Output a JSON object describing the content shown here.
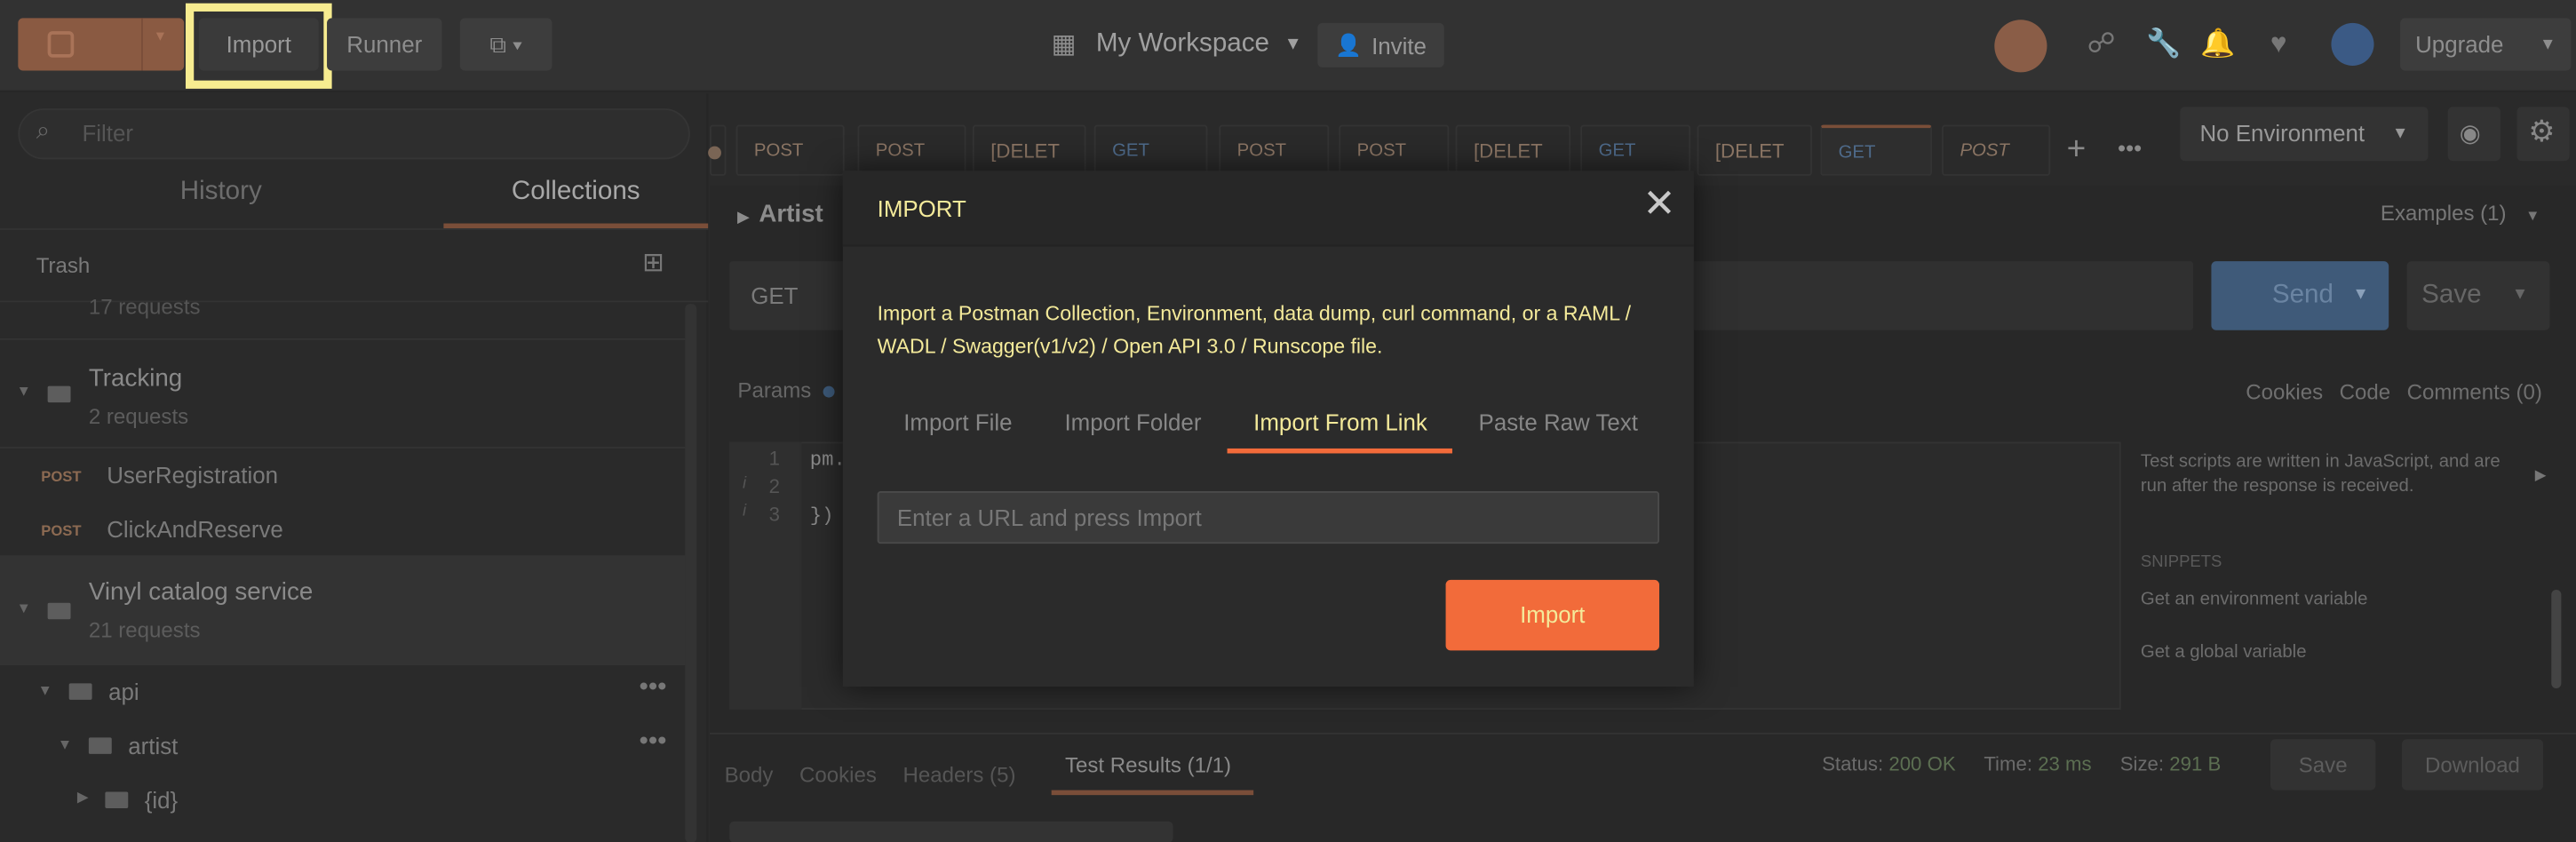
{
  "header": {
    "import_label": "Import",
    "runner_label": "Runner",
    "workspace_label": "My Workspace",
    "invite_label": "Invite",
    "upgrade_label": "Upgrade"
  },
  "sidebar": {
    "filter_placeholder": "Filter",
    "tabs": [
      "History",
      "Collections"
    ],
    "trash_label": "Trash",
    "partial_count": "17 requests",
    "tracking": {
      "name": "Tracking",
      "count": "2 requests"
    },
    "requests": [
      {
        "method": "POST",
        "name": "UserRegistration"
      },
      {
        "method": "POST",
        "name": "ClickAndReserve"
      }
    ],
    "vinyl": {
      "name": "Vinyl catalog service",
      "count": "21 requests"
    },
    "folders": [
      "api",
      "artist",
      "{id}"
    ]
  },
  "request": {
    "tabs": [
      "POST",
      "POST",
      "[DELET",
      "GET",
      "POST",
      "POST",
      "[DELET",
      "GET",
      "[DELET",
      "GET",
      "POST"
    ],
    "environment": "No Environment",
    "title": "Artist",
    "examples": "Examples (1)",
    "method": "GET",
    "send_label": "Send",
    "save_label": "Save",
    "params_label": "Params",
    "right_links": [
      "Cookies",
      "Code",
      "Comments (0)"
    ],
    "line_numbers": [
      "1",
      "2",
      "3"
    ],
    "code_lines": [
      "pm.",
      "",
      "})"
    ],
    "snippets_info": "Test scripts are written in JavaScript, and are run after the response is received.",
    "snippets_heading": "SNIPPETS",
    "snippets": [
      "Get an environment variable",
      "Get a global variable"
    ],
    "response_tabs": [
      "Body",
      "Cookies",
      "Headers (5)",
      "Test Results (1/1)"
    ],
    "status": {
      "status": "Status:",
      "status_value": "200 OK",
      "time": "Time:",
      "time_value": "23 ms",
      "size": "Size:",
      "size_value": "291 B"
    },
    "resp_save": "Save",
    "download": "Download"
  },
  "modal": {
    "title": "IMPORT",
    "description": "Import a Postman Collection, Environment, data dump, curl command, or a RAML / WADL / Swagger(v1/v2) / Open API 3.0 / Runscope file.",
    "tabs": [
      "Import File",
      "Import Folder",
      "Import From Link",
      "Paste Raw Text"
    ],
    "active_tab": "Import From Link",
    "url_placeholder": "Enter a URL and press Import",
    "import_button": "Import"
  }
}
